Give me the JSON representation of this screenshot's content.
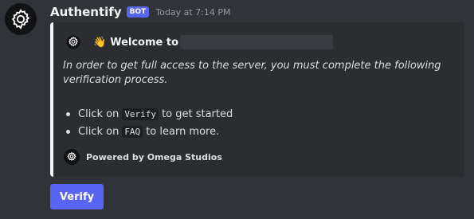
{
  "message": {
    "username": "Authentify",
    "bot_badge": "BOT",
    "timestamp": "Today at 7:14 PM",
    "avatar_icon": "gear-icon"
  },
  "embed": {
    "accent_color": "#f2f3f5",
    "author_icon": "gear-icon",
    "wave_emoji": "👋",
    "title": "Welcome to",
    "description": "In order to get full access to the server, you must complete the following verification process.",
    "list": [
      {
        "before": "Click on",
        "code": "Verify",
        "after": "to get started"
      },
      {
        "before": "Click on",
        "code": "FAQ",
        "after": "to learn more."
      }
    ],
    "footer_icon": "gear-icon",
    "footer_text": "Powered by Omega Studios"
  },
  "buttons": {
    "verify_label": "Verify",
    "color": "#5865f2"
  }
}
